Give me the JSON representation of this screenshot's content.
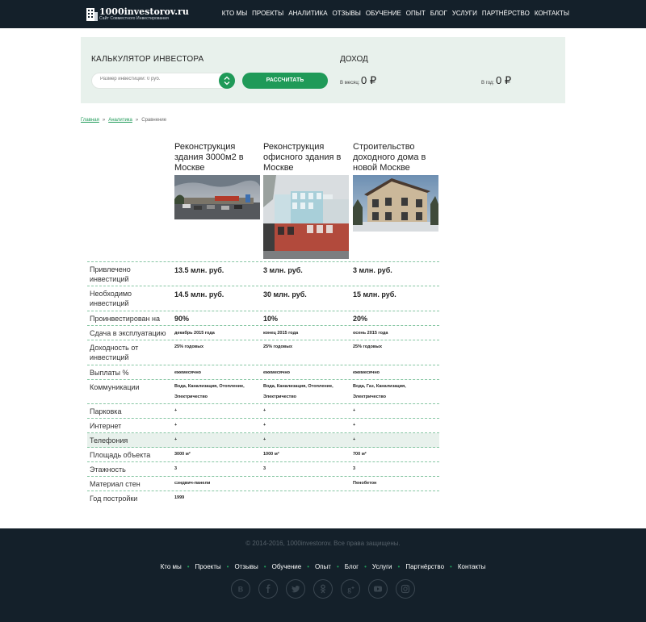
{
  "header": {
    "logo_title": "1000investorov.ru",
    "logo_subtitle": "Сайт Совместного Инвестирования",
    "nav": [
      "КТО МЫ",
      "ПРОЕКТЫ",
      "АНАЛИТИКА",
      "ОТЗЫВЫ",
      "ОБУЧЕНИЕ",
      "ОПЫТ",
      "БЛОГ",
      "УСЛУГИ",
      "ПАРТНЁРСТВО",
      "КОНТАКТЫ"
    ]
  },
  "calculator": {
    "title": "КАЛЬКУЛЯТОР ИНВЕСТОРА",
    "input_placeholder": "Размер инвестиций: 0 руб.",
    "button_label": "РАССЧИТАТЬ",
    "income_title": "ДОХОД",
    "month_label": "В месяц:",
    "month_value": "0 ₽",
    "year_label": "В год:",
    "year_value": "0 ₽"
  },
  "breadcrumb": {
    "home": "Главная",
    "separator": "»",
    "section": "Аналитика",
    "current": "Сравнение"
  },
  "projects": [
    {
      "title": "Реконструкция здания 3000м2 в Москве",
      "image": "parking-lot-photo"
    },
    {
      "title": "Реконструкция офисного здания в Москве",
      "image": "office-building-photo"
    },
    {
      "title": "Строительство доходного дома в новой Москве",
      "image": "house-photo"
    }
  ],
  "comparison": {
    "rows": [
      {
        "label": "Привлечено инвестиций",
        "values": [
          "13.5 млн. руб.",
          "3 млн. руб.",
          "3 млн. руб."
        ]
      },
      {
        "label": "Необходимо инвестиций",
        "values": [
          "14.5 млн. руб.",
          "30 млн. руб.",
          "15 млн. руб."
        ]
      },
      {
        "label": "Проинвестирован на",
        "values": [
          "90%",
          "10%",
          "20%"
        ]
      },
      {
        "label": "Сдача в эксплуатацию",
        "values": [
          "декабрь 2015 года",
          "конец 2015 года",
          "осень 2015 года"
        ]
      },
      {
        "label": "Доходность от инвестиций",
        "values": [
          "25% годовых",
          "25% годовых",
          "25% годовых"
        ]
      },
      {
        "label": "Выплаты %",
        "values": [
          "ежемесячно",
          "ежемесячно",
          "ежемесячно"
        ]
      },
      {
        "label": "Коммуникации",
        "values": [
          "Вода, Канализация, Отопление, Электричество",
          "Вода, Канализация, Отопление, Электричество",
          "Вода, Газ, Канализация, Электричество"
        ]
      },
      {
        "label": "Парковка",
        "values": [
          "+",
          "+",
          "+"
        ]
      },
      {
        "label": "Интернет",
        "values": [
          "+",
          "+",
          "+"
        ]
      },
      {
        "label": "Телефония",
        "values": [
          "+",
          "+",
          "+"
        ]
      },
      {
        "label": "Площадь объекта",
        "values": [
          "3000 м²",
          "1000 м²",
          "700 м²"
        ]
      },
      {
        "label": "Этажность",
        "values": [
          "3",
          "3",
          "3"
        ]
      },
      {
        "label": "Материал стен",
        "values": [
          "сэндвич-панели",
          "",
          "Пенобетон"
        ]
      },
      {
        "label": "Год постройки",
        "values": [
          "1999",
          "",
          ""
        ]
      }
    ]
  },
  "footer": {
    "copyright": "© 2014-2016, 1000investorov. Все права защищены.",
    "nav": [
      "Кто мы",
      "Проекты",
      "Отзывы",
      "Обучение",
      "Опыт",
      "Блог",
      "Услуги",
      "Партнёрство",
      "Контакты"
    ],
    "socials": [
      "vk-icon",
      "facebook-icon",
      "twitter-icon",
      "odnoklassniki-icon",
      "google-plus-icon",
      "youtube-icon",
      "instagram-icon"
    ]
  },
  "colors": {
    "header_bg": "#14202a",
    "accent": "#1f9a58",
    "calc_bg": "#e8f1ec"
  }
}
